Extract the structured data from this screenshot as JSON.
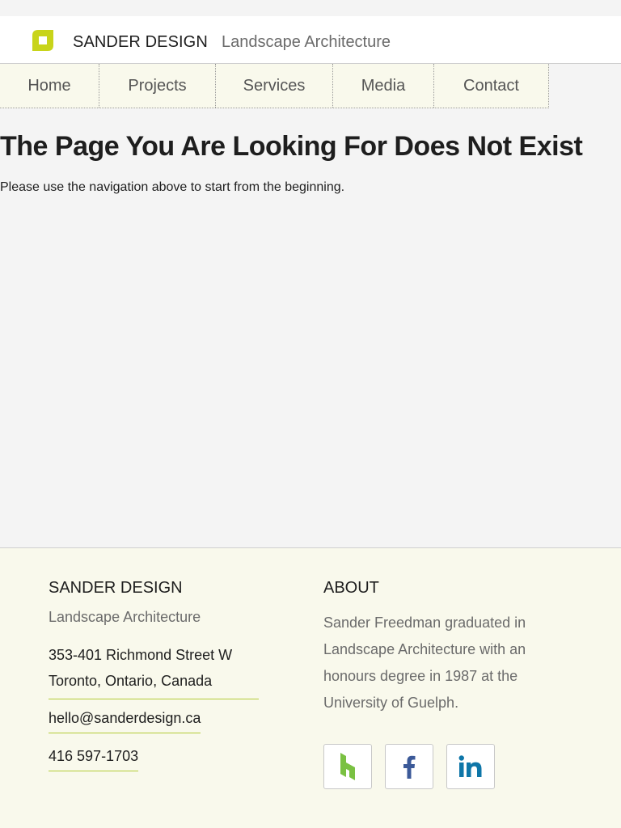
{
  "header": {
    "brand_name": "SANDER DESIGN",
    "tagline": "Landscape Architecture",
    "logo_icon": "leaf-square-icon",
    "accent_color": "#c8d41a"
  },
  "nav": {
    "items": [
      {
        "label": "Home"
      },
      {
        "label": "Projects"
      },
      {
        "label": "Services"
      },
      {
        "label": "Media"
      },
      {
        "label": "Contact"
      }
    ]
  },
  "main": {
    "title": "The Page You Are Looking For Does Not Exist",
    "message": "Please use the navigation above to start from the beginning."
  },
  "footer": {
    "brand_name": "SANDER DESIGN",
    "tagline": "Landscape Architecture",
    "address_line1": "353-401 Richmond Street W",
    "address_line2": "Toronto, Ontario, Canada",
    "email": "hello@sanderdesign.ca",
    "phone": "416 597-1703",
    "about_title": "ABOUT",
    "about_text": "Sander Freedman graduated in Landscape Architecture with an honours degree in 1987 at the University of Guelph.",
    "social": [
      {
        "icon": "houzz-icon",
        "color": "#7ac142"
      },
      {
        "icon": "facebook-icon",
        "color": "#3b5998"
      },
      {
        "icon": "linkedin-icon",
        "color": "#0e76a8"
      }
    ]
  }
}
